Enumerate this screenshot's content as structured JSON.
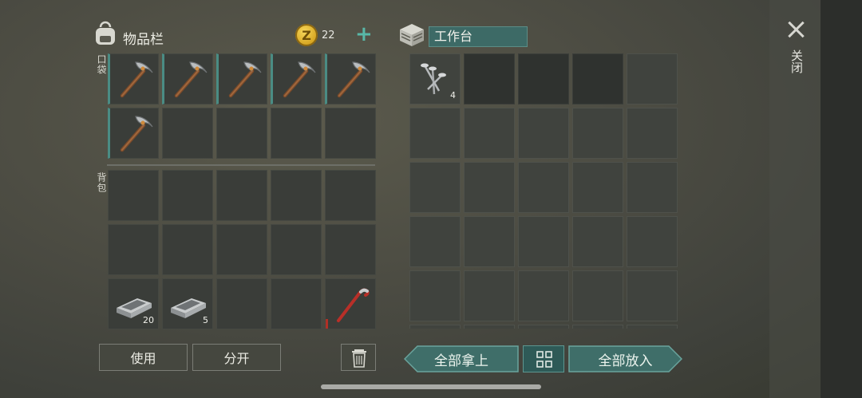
{
  "inventory": {
    "title": "物品栏",
    "coins": "22",
    "coin_symbol": "Z",
    "plus": "+"
  },
  "sections": {
    "pocket": "口袋",
    "backpack": "背包"
  },
  "pocket_slots": [
    {
      "item": "pickaxe"
    },
    {
      "item": "pickaxe"
    },
    {
      "item": "pickaxe"
    },
    {
      "item": "pickaxe"
    },
    {
      "item": "pickaxe"
    },
    {
      "item": "pickaxe"
    },
    {
      "item": ""
    },
    {
      "item": ""
    },
    {
      "item": ""
    },
    {
      "item": ""
    }
  ],
  "backpack_slots": [
    {
      "item": ""
    },
    {
      "item": ""
    },
    {
      "item": ""
    },
    {
      "item": ""
    },
    {
      "item": ""
    },
    {
      "item": ""
    },
    {
      "item": ""
    },
    {
      "item": ""
    },
    {
      "item": ""
    },
    {
      "item": ""
    },
    {
      "item": "iron-bar",
      "count": "20"
    },
    {
      "item": "iron-bar",
      "count": "5"
    },
    {
      "item": ""
    },
    {
      "item": ""
    },
    {
      "item": "crowbar"
    }
  ],
  "workbench": {
    "title": "工作台",
    "slots": [
      {
        "item": "nails",
        "count": "4"
      },
      {
        "item": "",
        "dark": true
      },
      {
        "item": "",
        "dark": true
      },
      {
        "item": "",
        "dark": true
      },
      {
        "item": ""
      },
      {
        "item": ""
      },
      {
        "item": ""
      },
      {
        "item": ""
      },
      {
        "item": ""
      },
      {
        "item": ""
      },
      {
        "item": ""
      },
      {
        "item": ""
      },
      {
        "item": ""
      },
      {
        "item": ""
      },
      {
        "item": ""
      },
      {
        "item": ""
      },
      {
        "item": ""
      },
      {
        "item": ""
      },
      {
        "item": ""
      },
      {
        "item": ""
      },
      {
        "item": ""
      },
      {
        "item": ""
      },
      {
        "item": ""
      },
      {
        "item": ""
      },
      {
        "item": ""
      },
      {
        "item": ""
      },
      {
        "item": ""
      },
      {
        "item": ""
      },
      {
        "item": ""
      },
      {
        "item": ""
      }
    ]
  },
  "buttons": {
    "use": "使用",
    "split": "分开",
    "take_all": "全部拿上",
    "put_all": "全部放入",
    "close": "关闭"
  },
  "colors": {
    "accent": "#4a8c84",
    "button_teal": "#3d6a66",
    "coin_gold": "#d7a622"
  }
}
